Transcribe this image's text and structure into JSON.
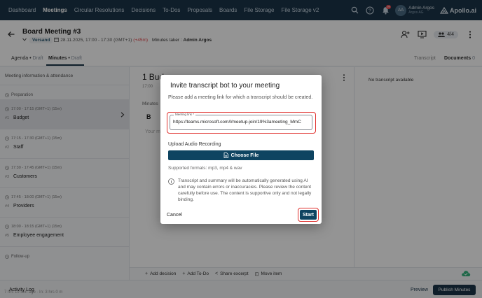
{
  "topnav": {
    "items": [
      "Dashboard",
      "Meetings",
      "Circular Resolutions",
      "Decisions",
      "To-Dos",
      "Proposals",
      "Boards",
      "File Storage",
      "File Storage v2"
    ],
    "active": "Meetings",
    "notification_count": "99",
    "user": {
      "initials": "AA",
      "name": "Admin Argos",
      "org": "Argos AG"
    },
    "logo_text": "Apollo.ai"
  },
  "meeting": {
    "title": "Board Meeting #3",
    "status": "Versand",
    "date": "28.11.2025, 17:00 - 17:30 (GMT+1)",
    "timezone_note": "(+45m)",
    "minutes_taker_label": "Minutes taker :",
    "minutes_taker": "Admin Argos",
    "participants": "4/4"
  },
  "tabs": {
    "agenda": "Agenda",
    "agenda_sub": "Draft",
    "minutes": "Minutes",
    "minutes_sub": "Draft",
    "transcript": "Transcript",
    "documents": "Documents",
    "documents_count": "0"
  },
  "agenda": {
    "header": "Meeting information & attendance",
    "preparation": "Preparation",
    "follow_up": "Follow-up",
    "items": [
      {
        "num": "#1",
        "title": "Budget",
        "time": "17:00 - 17:15 (GMT+1) (15m)"
      },
      {
        "num": "#2",
        "title": "Staff",
        "time": "17:15 - 17:30 (GMT+1) (15m)"
      },
      {
        "num": "#3",
        "title": "Customers",
        "time": "17:30 - 17:45 (GMT+1) (15m)"
      },
      {
        "num": "#4",
        "title": "Providers",
        "time": "17:45 - 18:00 (GMT+1) (15m)"
      },
      {
        "num": "#5",
        "title": "Employee engagement",
        "time": "18:00 - 18:15 (GMT+1) (15m)"
      }
    ]
  },
  "content": {
    "num": "1",
    "title": "Bud",
    "sub": "17:00",
    "minutes": "Minutes",
    "bold": "B",
    "placeholder": "Your m"
  },
  "transcript_panel": {
    "empty": "No transcript available"
  },
  "toolbar": {
    "add_decision": "Add decision",
    "add_todo": "Add To-Do",
    "share_excerpt": "Share excerpt",
    "move_item": "Move item"
  },
  "footer": {
    "activity_log": "Activity Log",
    "activity_sub": "7 hrs 19 min ago · In: 3 hrs 0 m",
    "preview": "Preview",
    "publish": "Publish Minutes"
  },
  "modal": {
    "title": "Invite transcript bot to your meeting",
    "description": "Please add a meeting link for which a transcript should be created.",
    "field_label": "Meeting link *",
    "field_value": "https://teams.microsoft.com/l/meetup-join/19%3ameeting_MmC",
    "upload_label": "Upload Audio Recording",
    "choose_file": "Choose File",
    "formats": "Supported formats: mp3, mp4 & wav",
    "disclaimer": "Transcript and summary will be automatically generated using AI and may contain errors or inaccuracies. Please review the content carefully before use. The content is supportive only and not legally binding.",
    "cancel": "Cancel",
    "start": "Start"
  },
  "colors": {
    "nav_bg": "#1a3549",
    "primary_button": "#0e4461",
    "highlight": "#e0302d",
    "overlay": "rgba(0,0,0,0.42)"
  }
}
